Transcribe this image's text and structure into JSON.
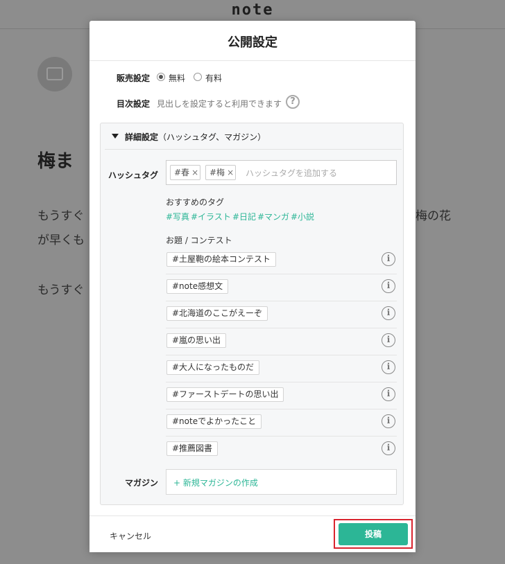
{
  "background": {
    "logo": "note",
    "title_fragment": "梅ま",
    "line1_left": "もうすぐ",
    "line1_right": "梅の花",
    "line2_left": "が早くも",
    "line3_left": "もうすぐ"
  },
  "modal": {
    "title": "公開設定",
    "sales": {
      "label": "販売設定",
      "options": [
        "無料",
        "有料"
      ],
      "selected": "無料"
    },
    "toc": {
      "label": "目次設定",
      "description": "見出しを設定すると利用できます",
      "help": "?"
    },
    "details": {
      "title_main": "詳細設定",
      "title_sub": "（ハッシュタグ、マガジン）",
      "hashtag": {
        "label": "ハッシュタグ",
        "tags": [
          "#春",
          "#梅"
        ],
        "remove_glyph": "×",
        "placeholder": "ハッシュタグを追加する"
      },
      "recommended": {
        "title": "おすすめのタグ",
        "tags": [
          "#写真",
          "#イラスト",
          "#日記",
          "#マンガ",
          "#小説"
        ]
      },
      "contests": {
        "title": "お題 / コンテスト",
        "items": [
          "#土屋鞄の絵本コンテスト",
          "#note感想文",
          "#北海道のここがえーぞ",
          "#嵐の思い出",
          "#大人になったものだ",
          "#ファーストデートの思い出",
          "#noteでよかったこと",
          "#推薦図書"
        ],
        "info_glyph": "i"
      },
      "magazine": {
        "label": "マガジン",
        "create_link": "+ 新規マガジンの作成"
      }
    },
    "footer": {
      "cancel": "キャンセル",
      "post": "投稿"
    }
  },
  "colors": {
    "accent": "#2cb696",
    "highlight": "#d9242e"
  }
}
